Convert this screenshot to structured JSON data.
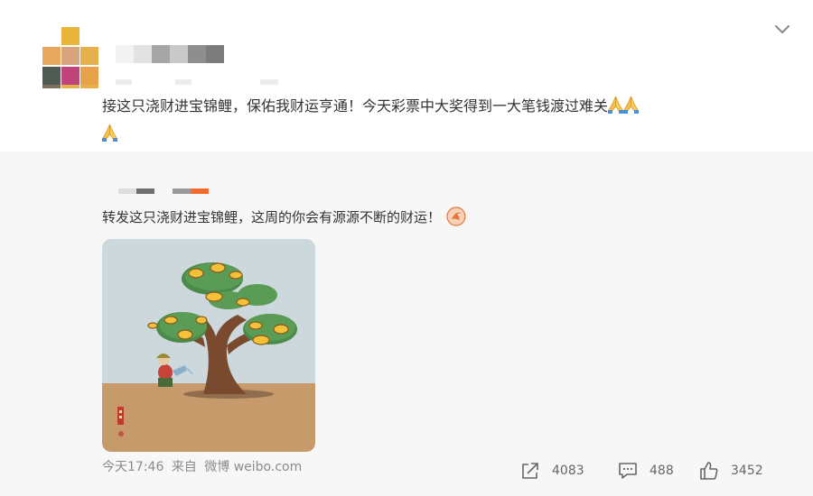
{
  "post": {
    "text": "接这只浇财进宝锦鲤，保佑我财运亨通！今天彩票中大奖得到一大笔钱渡过难关",
    "emoji_icons": [
      "folded-hands-icon",
      "folded-hands-icon",
      "folded-hands-icon"
    ]
  },
  "repost": {
    "text": "转发这只浇财进宝锦鲤，这周的你会有源源不断的财运！",
    "sticker_icon": "fortune-sticker-icon"
  },
  "meta": {
    "time": "今天17:46",
    "from_label": "来自",
    "source": "微博 weibo.com"
  },
  "actions": {
    "share_count": "4083",
    "comment_count": "488",
    "like_count": "3452"
  },
  "icons": {
    "share": "share-icon",
    "comment": "comment-icon",
    "like": "thumbs-up-icon",
    "menu": "chevron-down-icon"
  },
  "colors": {
    "text": "#333333",
    "meta": "#8a8a8a",
    "repost_bg": "#f7f7f7",
    "accent_orange": "#f26b2a",
    "avatar_pixels": [
      "#e9b43a",
      "#e7a85d",
      "#c9a07a",
      "#4f5a52",
      "#c0447a",
      "#e8a24a",
      "#7a6e5c",
      "#e6b04a",
      "#e3b24e"
    ]
  }
}
